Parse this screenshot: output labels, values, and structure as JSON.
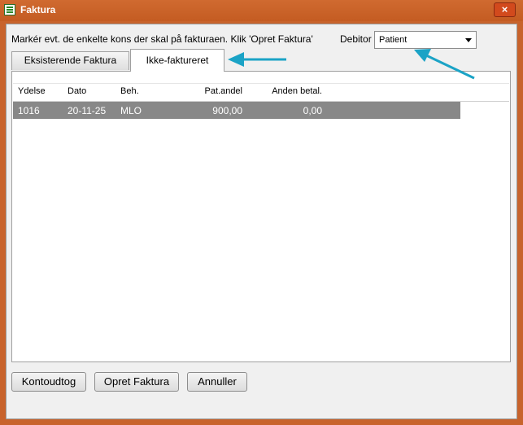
{
  "window": {
    "title": "Faktura",
    "close_label": "×"
  },
  "instruction": "Markér evt. de enkelte kons der skal på fakturaen. Klik 'Opret Faktura'",
  "debitor": {
    "label": "Debitor",
    "selected": "Patient"
  },
  "tabs": [
    {
      "label": "Eksisterende Faktura",
      "active": false
    },
    {
      "label": "Ikke-faktureret",
      "active": true
    }
  ],
  "table": {
    "columns": [
      "Ydelse",
      "Dato",
      "Beh.",
      "Pat.andel",
      "Anden betal."
    ],
    "rows": [
      [
        "1016",
        "20-11-25",
        "MLO",
        "900,00",
        "0,00"
      ]
    ]
  },
  "buttons": {
    "kontoudtog": "Kontoudtog",
    "opret": "Opret Faktura",
    "annuller": "Annuller"
  },
  "colors": {
    "titlebar": "#c8632c",
    "selected_row": "#888888",
    "annotation_arrow": "#1ba3c6"
  }
}
